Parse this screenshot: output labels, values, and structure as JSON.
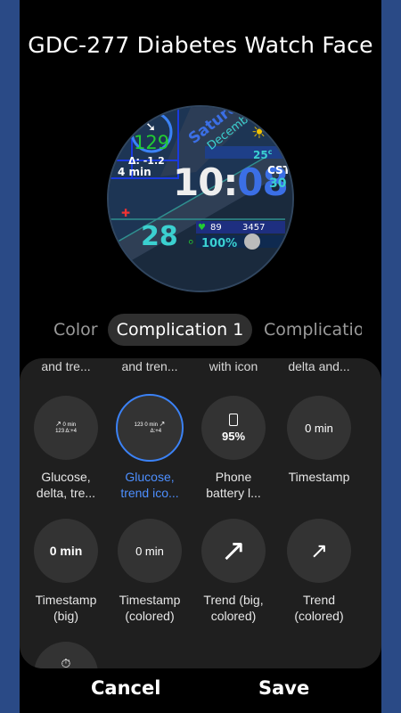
{
  "header": {
    "title": "GDC-277 Diabetes Watch Face"
  },
  "watch": {
    "glucose": "129",
    "delta": "Δ: -1.2",
    "age": "4 min",
    "day": "Saturday",
    "month": "December",
    "temp": "25",
    "temp_unit": "c",
    "time_hour": "10",
    "time_colon": ":",
    "time_min": "08",
    "tz": "CST",
    "tz_num": "30",
    "date": "28",
    "heart": "89",
    "steps": "3457",
    "battery": "100%"
  },
  "tabs": {
    "color": "Color",
    "comp1": "Complication 1",
    "comp2": "Complicatio"
  },
  "cut_labels": [
    "and tre...",
    "and tren...",
    "with icon",
    "delta and..."
  ],
  "options": [
    {
      "label1": "Glucose,",
      "label2": "delta, tre...",
      "icon": "glucose-delta-trend"
    },
    {
      "label1": "Glucose,",
      "label2": "trend ico...",
      "icon": "glucose-trend-icon"
    },
    {
      "label1": "Phone",
      "label2": "battery l...",
      "icon": "phone-battery",
      "value": "95%"
    },
    {
      "label1": "Timestamp",
      "label2": "",
      "icon": "timestamp",
      "value": "0 min"
    },
    {
      "label1": "Timestamp",
      "label2": "(big)",
      "icon": "timestamp-big",
      "value": "0 min"
    },
    {
      "label1": "Timestamp",
      "label2": "(colored)",
      "icon": "timestamp-colored",
      "value": "0 min"
    },
    {
      "label1": "Trend (big,",
      "label2": "colored)",
      "icon": "trend-big"
    },
    {
      "label1": "Trend",
      "label2": "(colored)",
      "icon": "trend-colored"
    }
  ],
  "mini": {
    "g1_num": "123",
    "g1_min": "0 min",
    "g1_delta": "Δ:+4",
    "g2_num": "123",
    "g2_min": "0 min",
    "g2_delta": "Δ:+4"
  },
  "footer": {
    "cancel": "Cancel",
    "save": "Save"
  }
}
